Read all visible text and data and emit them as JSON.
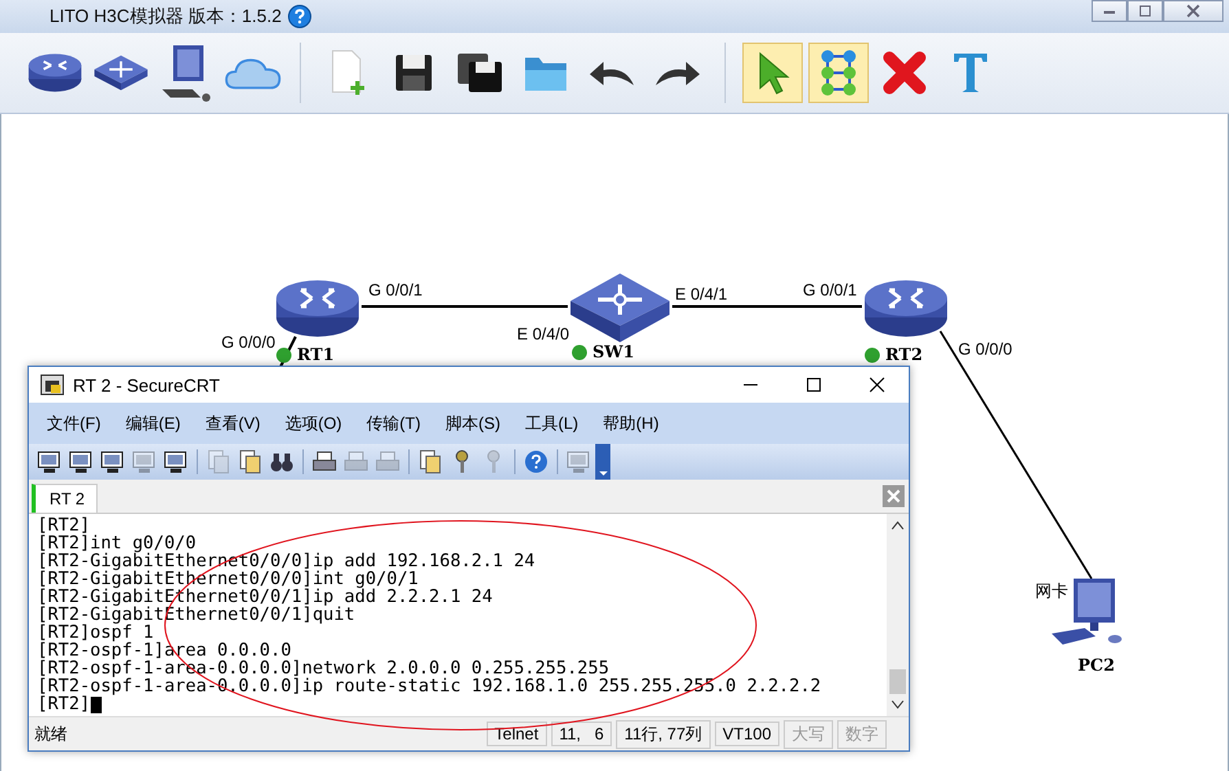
{
  "app": {
    "title": "LITO H3C模拟器 版本：1.5.2"
  },
  "toolbar": [
    [
      {
        "kind": "router",
        "selected": false
      },
      {
        "kind": "switch",
        "selected": false
      },
      {
        "kind": "pc",
        "selected": false
      },
      {
        "kind": "cloud",
        "selected": false
      }
    ],
    [
      {
        "kind": "new",
        "selected": false
      },
      {
        "kind": "save",
        "selected": false
      },
      {
        "kind": "saveas",
        "selected": false
      },
      {
        "kind": "open",
        "selected": false
      },
      {
        "kind": "undo",
        "selected": false
      },
      {
        "kind": "redo",
        "selected": false
      }
    ],
    [
      {
        "kind": "select",
        "selected": true
      },
      {
        "kind": "connect",
        "selected": true
      },
      {
        "kind": "delete",
        "selected": false
      },
      {
        "kind": "text",
        "selected": false
      }
    ]
  ],
  "canvas": {
    "nodes": [
      {
        "name": "RT1",
        "kind": "router",
        "online": true
      },
      {
        "name": "SW1",
        "kind": "switch",
        "online": true
      },
      {
        "name": "RT2",
        "kind": "router",
        "online": true
      },
      {
        "name": "PC2",
        "kind": "pc",
        "online": false
      }
    ],
    "ports": [
      "G 0/0/1",
      "G 0/0/0",
      "E 0/4/0",
      "E 0/4/1",
      "G 0/0/1",
      "G 0/0/0",
      "网卡"
    ]
  },
  "terminal_window": {
    "title": "RT 2 - SecureCRT",
    "menu": [
      "文件(F)",
      "编辑(E)",
      "查看(V)",
      "选项(O)",
      "传输(T)",
      "脚本(S)",
      "工具(L)",
      "帮助(H)"
    ],
    "toolbar": [
      [
        {
          "kind": "monitor",
          "disabled": false
        },
        {
          "kind": "monitor",
          "disabled": false
        },
        {
          "kind": "monitor",
          "disabled": false
        },
        {
          "kind": "monitor",
          "disabled": true
        },
        {
          "kind": "monitor",
          "disabled": false
        }
      ],
      [
        {
          "kind": "page",
          "disabled": true
        },
        {
          "kind": "page",
          "disabled": false
        },
        {
          "kind": "binoculars",
          "disabled": false
        }
      ],
      [
        {
          "kind": "printer",
          "disabled": false
        },
        {
          "kind": "printer",
          "disabled": true
        },
        {
          "kind": "printer",
          "disabled": true
        }
      ],
      [
        {
          "kind": "page",
          "disabled": false
        },
        {
          "kind": "key",
          "disabled": false
        },
        {
          "kind": "key",
          "disabled": true
        }
      ],
      [
        {
          "kind": "help",
          "disabled": false
        }
      ],
      [
        {
          "kind": "monitor",
          "disabled": true
        }
      ]
    ],
    "tabs": [
      {
        "label": "RT 2",
        "selected": true
      }
    ],
    "lines": [
      "[RT2]",
      "[RT2]int g0/0/0",
      "[RT2-GigabitEthernet0/0/0]ip add 192.168.2.1 24",
      "[RT2-GigabitEthernet0/0/0]int g0/0/1",
      "[RT2-GigabitEthernet0/0/1]ip add 2.2.2.1 24",
      "[RT2-GigabitEthernet0/0/1]quit",
      "[RT2]ospf 1",
      "[RT2-ospf-1]area 0.0.0.0",
      "[RT2-ospf-1-area-0.0.0.0]network 2.0.0.0 0.255.255.255",
      "[RT2-ospf-1-area-0.0.0.0]ip route-static 192.168.1.0 255.255.255.0 2.2.2.2",
      "[RT2]"
    ],
    "cursor": true,
    "status": "就绪",
    "status_cells": [
      {
        "text": "Telnet",
        "disabled": false
      },
      {
        "text": "11,   6",
        "disabled": false
      },
      {
        "text": "11行, 77列",
        "disabled": false
      },
      {
        "text": "VT100",
        "disabled": false
      },
      {
        "text": "大写",
        "disabled": true
      },
      {
        "text": "数字",
        "disabled": true
      }
    ]
  }
}
